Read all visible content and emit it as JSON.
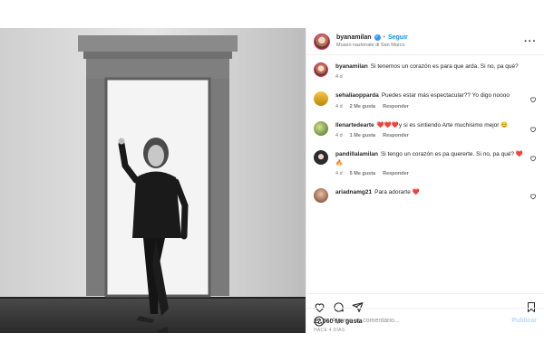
{
  "post": {
    "username": "byanamilan",
    "verified": true,
    "follow_label": "Seguir",
    "separator": "•",
    "location": "Museo nazionale di San Marco",
    "caption": "Si tenemos un corazón es para que arda. Si no, pa qué?",
    "caption_time": "4 d"
  },
  "comments": [
    {
      "username": "sehaliaopparda",
      "text": "Puedes estar más espectacular?? Yo digo noooo",
      "time": "4 d",
      "likes": "2 Me gusta",
      "reply": "Responder"
    },
    {
      "username": "llenartedearte",
      "text": "❤️❤️❤️y si es sintiendo Arte muchisimo mejor ☺️",
      "time": "4 d",
      "likes": "1 Me gusta",
      "reply": "Responder"
    },
    {
      "username": "pandillalamilan",
      "text": "Si tengo un corazón es pa quererte. Si no, pa qué? ❤️🔥",
      "time": "4 d",
      "likes": "5 Me gusta",
      "reply": "Responder"
    },
    {
      "username": "ariadnamg21",
      "text": "Para adorarte ❤️",
      "time": "",
      "likes": "",
      "reply": ""
    }
  ],
  "actions": {
    "likes": "27,060 Me gusta",
    "time_ago": "HACE 4 DÍAS"
  },
  "add_comment": {
    "placeholder": "Agrega un comentario...",
    "post_label": "Publicar"
  },
  "icons": {
    "more": "more-options-icon",
    "like": "heart-icon",
    "comment": "comment-icon",
    "share": "share-icon",
    "save": "bookmark-icon",
    "emoji": "emoji-icon"
  },
  "colors": {
    "accent": "#0095f6",
    "verified": "#3897f0"
  }
}
